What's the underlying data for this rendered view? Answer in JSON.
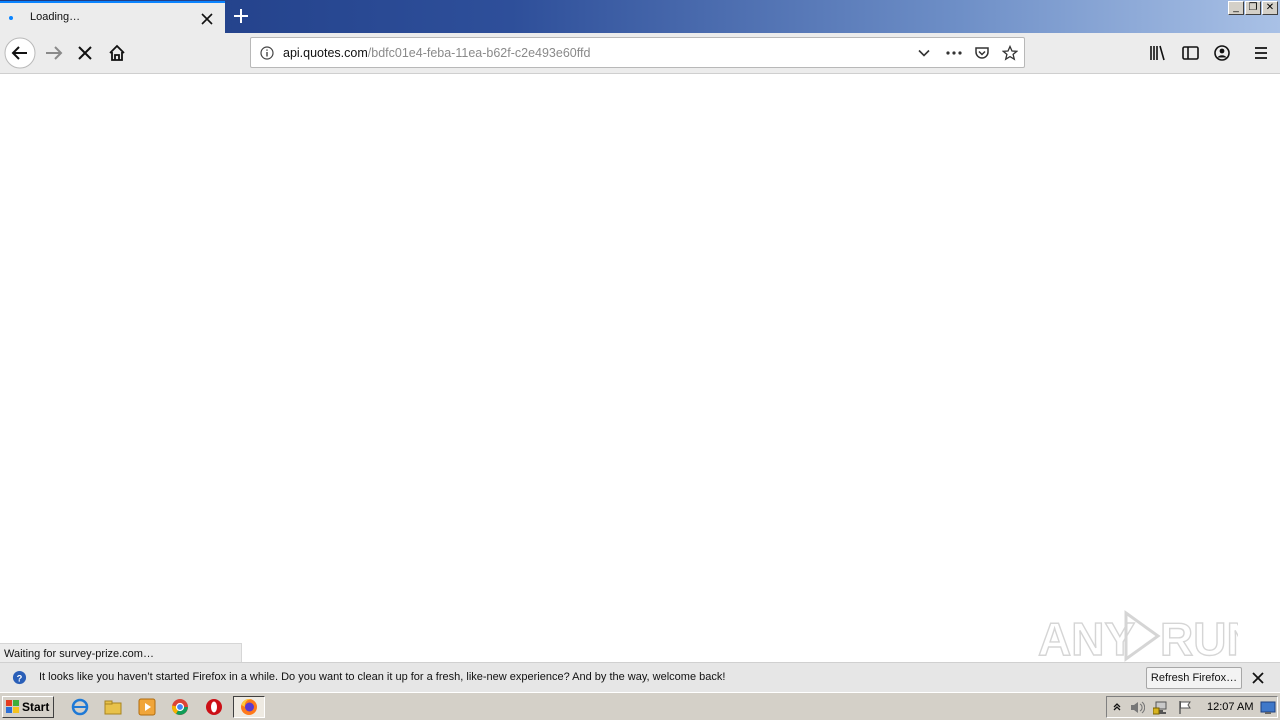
{
  "tab": {
    "title": "Loading…"
  },
  "address_bar": {
    "host": "api.quotes.com",
    "path": "/bdfc01e4-feba-11ea-b62f-c2e493e60ffd"
  },
  "status": {
    "text": "Waiting for survey-prize.com…"
  },
  "notification": {
    "message": "It looks like you haven’t started Firefox in a while. Do you want to clean it up for a fresh, like-new experience? And by the way, welcome back!",
    "button_label": "Refresh Firefox…"
  },
  "watermark": {
    "text": "ANY RUN"
  },
  "taskbar": {
    "start_label": "Start",
    "clock": "12:07 AM"
  },
  "window_controls": {
    "minimize": "_",
    "restore": "❐",
    "close": "✕"
  },
  "colors": {
    "accent": "#0a84ff",
    "titlebar": "#1d3a82",
    "taskbar": "#d4d0c8"
  }
}
